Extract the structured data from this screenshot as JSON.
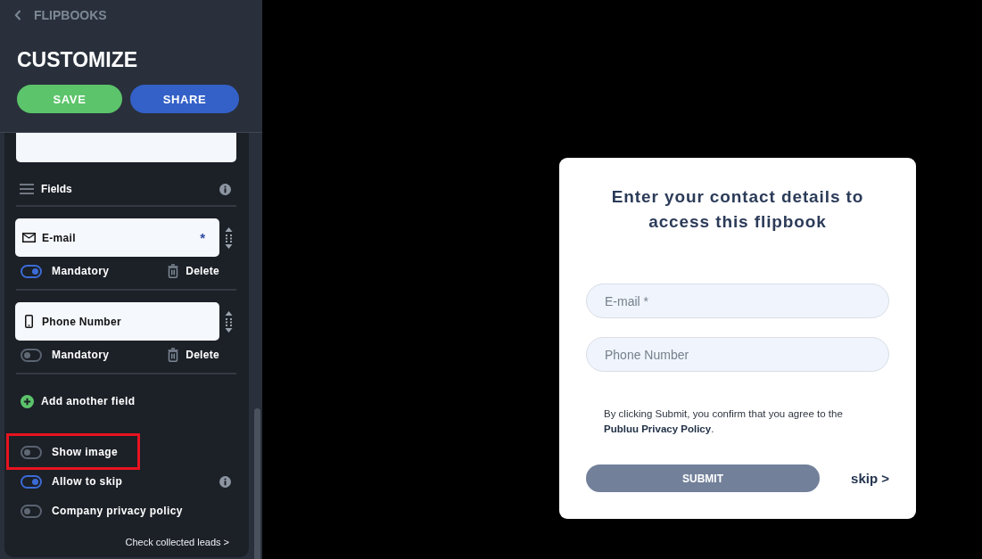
{
  "sidebar": {
    "back_link": {
      "label": "FLIPBOOKS"
    },
    "title": "CUSTOMIZE",
    "buttons": [
      {
        "label": "SAVE",
        "kind": "save"
      },
      {
        "label": "SHARE",
        "kind": "share"
      }
    ],
    "fields_section": {
      "title": "Fields",
      "fields": [
        {
          "kind": "email",
          "label": "E-mail",
          "required_mark": "*",
          "mandatory": true,
          "mandatory_label": "Mandatory",
          "delete_label": "Delete"
        },
        {
          "kind": "phone",
          "label": "Phone Number",
          "mandatory": false,
          "mandatory_label": "Mandatory",
          "delete_label": "Delete"
        }
      ],
      "add_label": "Add another field"
    },
    "options": [
      {
        "label": "Show image",
        "on": false,
        "highlighted": true,
        "info": false
      },
      {
        "label": "Allow to skip",
        "on": true,
        "highlighted": false,
        "info": true
      },
      {
        "label": "Company privacy policy",
        "on": false,
        "highlighted": false,
        "info": false
      }
    ],
    "leads_link": "Check collected leads >"
  },
  "form": {
    "title": "Enter your contact details to access this flipbook",
    "inputs": [
      {
        "placeholder": "E-mail *"
      },
      {
        "placeholder": "Phone Number"
      }
    ],
    "consent": "By clicking Submit, you confirm that you agree to the **Publuu Privacy Policy**.",
    "submit": "SUBMIT",
    "skip": "skip >"
  }
}
